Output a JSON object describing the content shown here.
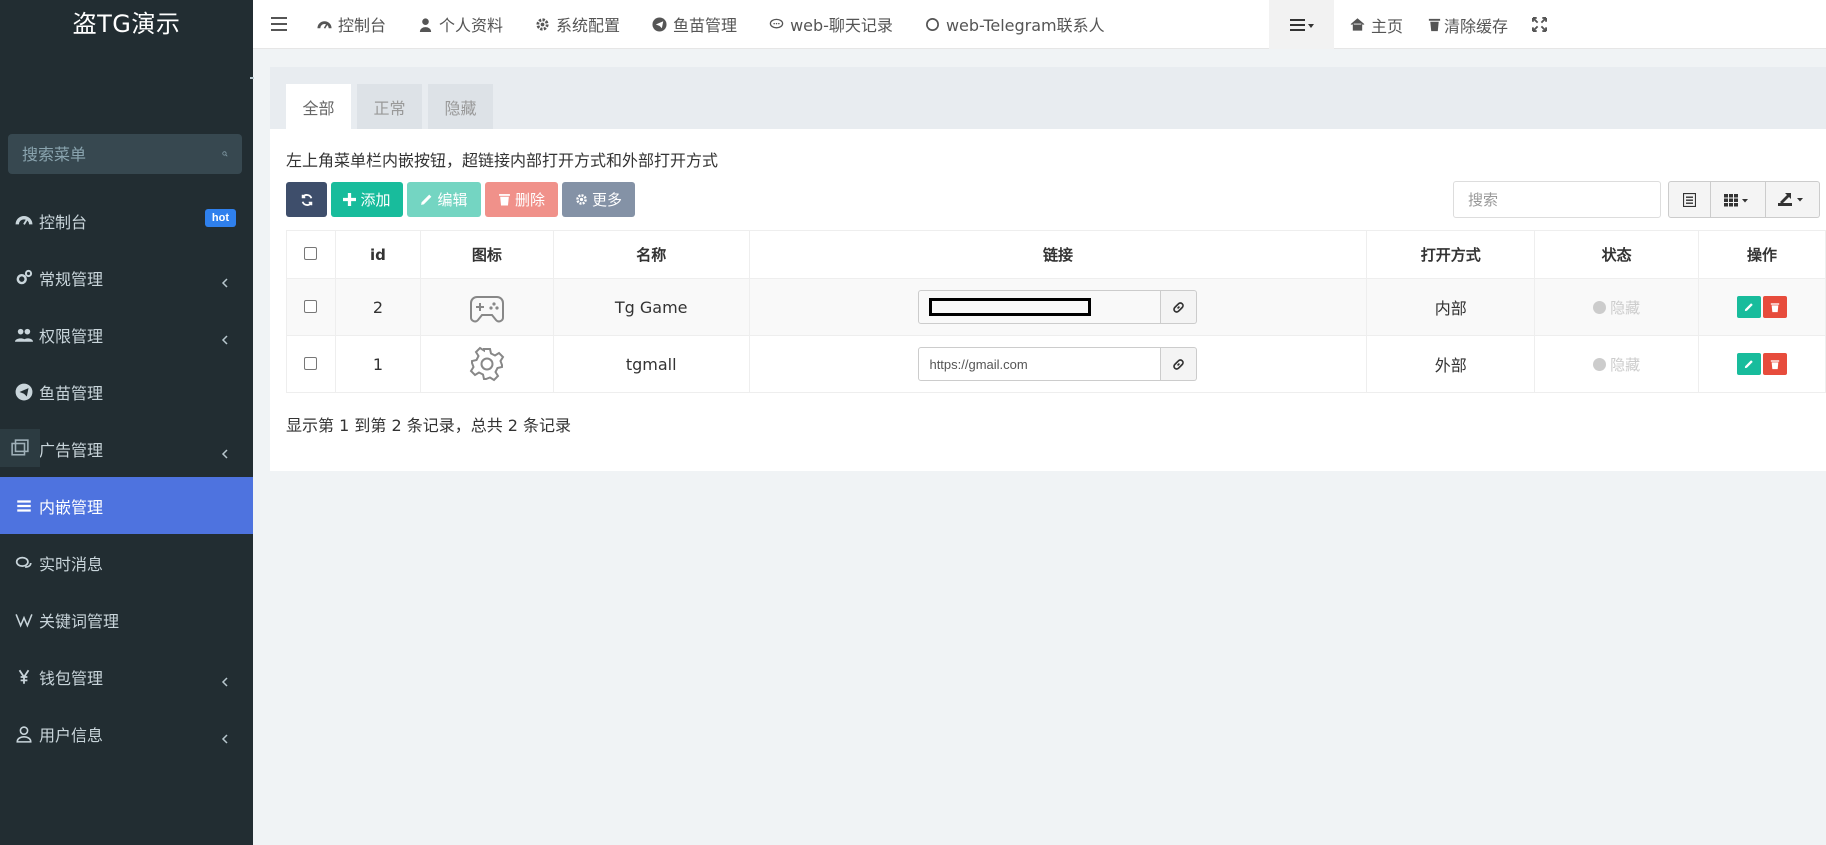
{
  "sidebar": {
    "brand": "盗TG演示",
    "search_placeholder": "搜索菜单",
    "items": [
      {
        "label": "控制台",
        "badge": "hot"
      },
      {
        "label": "常规管理"
      },
      {
        "label": "权限管理"
      },
      {
        "label": "鱼苗管理"
      },
      {
        "label": "广告管理"
      },
      {
        "label": "内嵌管理"
      },
      {
        "label": "实时消息"
      },
      {
        "label": "关键词管理"
      },
      {
        "label": "钱包管理"
      },
      {
        "label": "用户信息"
      }
    ]
  },
  "topnav": {
    "links": [
      "控制台",
      "个人资料",
      "系统配置",
      "鱼苗管理",
      "web-聊天记录",
      "web-Telegram联系人"
    ],
    "right": [
      "主页",
      "清除缓存"
    ]
  },
  "tabs": [
    "全部",
    "正常",
    "隐藏"
  ],
  "description": "左上角菜单栏内嵌按钮，超链接内部打开方式和外部打开方式",
  "toolbar": {
    "add": "添加",
    "edit": "编辑",
    "delete": "删除",
    "more": "更多"
  },
  "search_placeholder": "搜索",
  "table": {
    "headers": [
      "id",
      "图标",
      "名称",
      "链接",
      "打开方式",
      "状态",
      "操作"
    ],
    "rows": [
      {
        "id": "2",
        "icon": "gamepad-icon",
        "name": "Tg Game",
        "link": "",
        "open": "内部",
        "status": "隐藏"
      },
      {
        "id": "1",
        "icon": "gear-icon",
        "name": "tgmall",
        "link": "https://gmail.com",
        "open": "外部",
        "status": "隐藏"
      }
    ]
  },
  "footer": "显示第 1 到第 2 条记录，总共 2 条记录",
  "colors": {
    "sidebar_bg": "#222d32",
    "active": "#4e73df",
    "success": "#18bc9c",
    "danger": "#e74c3c"
  }
}
